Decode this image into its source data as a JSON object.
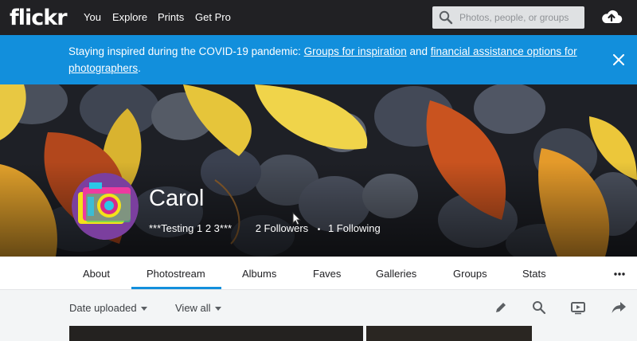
{
  "nav": {
    "logo": "flickr",
    "links": [
      "You",
      "Explore",
      "Prints",
      "Get Pro"
    ],
    "search_placeholder": "Photos, people, or groups"
  },
  "banner": {
    "text_before": "Staying inspired during the COVID-19 pandemic: ",
    "link1": "Groups for inspiration",
    "text_middle": " and ",
    "link2": "financial assistance options for photographers",
    "text_after": "."
  },
  "profile": {
    "name": "Carol",
    "tagline": "***Testing 1 2 3***",
    "followers": "2 Followers",
    "separator": "•",
    "following": "1 Following"
  },
  "tabs": [
    "About",
    "Photostream",
    "Albums",
    "Faves",
    "Galleries",
    "Groups",
    "Stats"
  ],
  "active_tab": "Photostream",
  "toolbar": {
    "sort_label": "Date uploaded",
    "view_label": "View all"
  },
  "colors": {
    "nav_bg": "#212124",
    "banner_bg": "#128fdc",
    "accent": "#128fdc"
  }
}
